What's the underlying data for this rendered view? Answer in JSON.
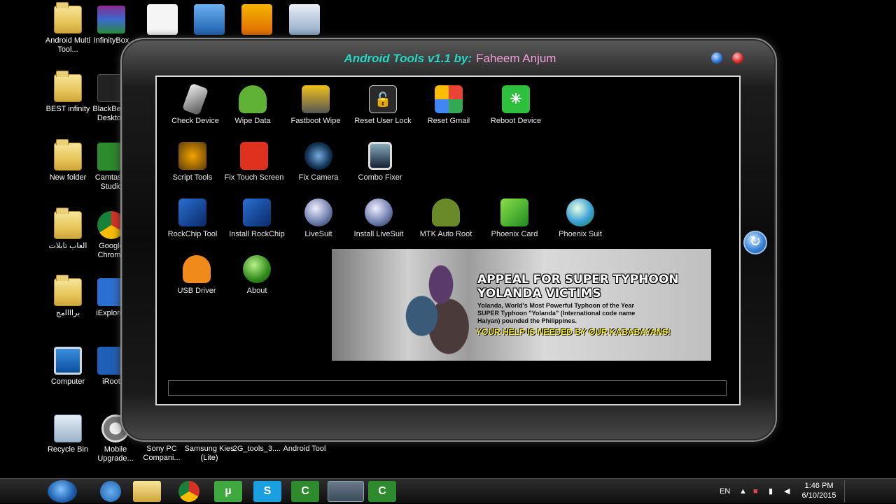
{
  "desktop": {
    "icons_col1": [
      {
        "label": "Android Multi Tool...",
        "icon": "folder-icon"
      },
      {
        "label": "BEST infinity",
        "icon": "folder-icon"
      },
      {
        "label": "New folder",
        "icon": "folder-icon"
      },
      {
        "label": "العاب تابلات",
        "icon": "folder-icon"
      },
      {
        "label": "براااامج",
        "icon": "folder-icon"
      },
      {
        "label": "Computer",
        "icon": "computer-icon"
      },
      {
        "label": "Recycle Bin",
        "icon": "recycle-bin-icon"
      }
    ],
    "icons_col2": [
      {
        "label": "InfinityBox",
        "icon": "winrar-icon"
      },
      {
        "label": "BlackBerry Desktop",
        "icon": "blackberry-icon"
      },
      {
        "label": "Camtasia Studio",
        "icon": "camtasia-icon"
      },
      {
        "label": "Google Chrome",
        "icon": "chrome-icon"
      },
      {
        "label": "iExplorer",
        "icon": "iexplorer-icon"
      },
      {
        "label": "iRoot",
        "icon": "iroot-icon"
      },
      {
        "label": "Mobile Upgrade...",
        "icon": "settings-gear-icon"
      }
    ],
    "bottom_row": [
      "Sony PC Compani...",
      "Samsung Kies (Lite)",
      "2G_tools_3....",
      "Android Tool"
    ]
  },
  "app": {
    "title_prefix": "Android Tools v1.1 by:",
    "author": "Faheem Anjum",
    "tools_row1": [
      "Check Device",
      "Wipe Data",
      "Fastboot Wipe",
      "Reset User Lock",
      "Reset Gmail",
      "Reboot Device"
    ],
    "tools_row2": [
      "Script Tools",
      "Fix Touch Screen",
      "Fix Camera",
      "Combo Fixer"
    ],
    "tools_row3": [
      "RockChip Tool",
      "Install RockChip",
      "LiveSuit",
      "Install LiveSuit",
      "MTK Auto Root",
      "Phoenix Card",
      "Phoenix Suit"
    ],
    "tools_row4": [
      "USB Driver",
      "About"
    ],
    "banner": {
      "headline_line1": "APPEAL FOR SUPER TYPHOON",
      "headline_line2": "YOLANDA VICTIMS",
      "sub_line1": "Yolanda, World's Most Powerful Typhoon of the Year",
      "sub_line2": "SUPER Typhoon \"Yolanda\" (International code name",
      "sub_line3": "Haiyan) pounded the Philippines.",
      "callout": "YOUR HELP IS NEEDED BY OUR KABABAYANS!"
    },
    "progress": 0
  },
  "taskbar": {
    "language": "EN",
    "time": "1:46 PM",
    "date": "6/10/2015"
  }
}
